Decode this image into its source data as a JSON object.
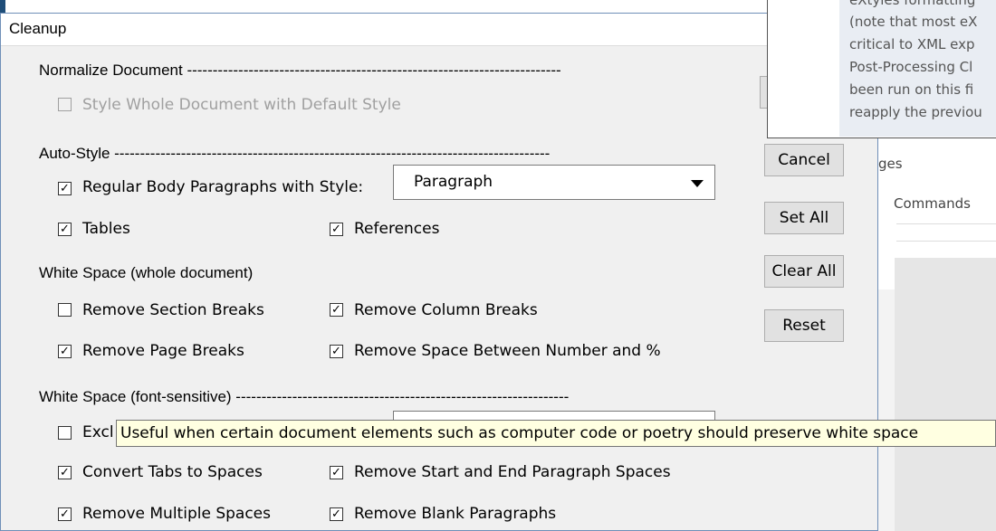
{
  "dialog": {
    "title": "Cleanup"
  },
  "normalize": {
    "header": "Normalize Document -------------------------------------------------------------------------",
    "style_whole": "Style Whole Document with Default Style"
  },
  "autostyle": {
    "header": "Auto-Style -------------------------------------------------------------------------------------",
    "regular_label": "Regular Body Paragraphs with Style:",
    "style_value": "Paragraph",
    "tables": "Tables",
    "references": "References"
  },
  "whitespace_doc": {
    "header": "White Space (whole document)",
    "remove_section": "Remove Section Breaks",
    "remove_column": "Remove Column Breaks",
    "remove_page": "Remove Page Breaks",
    "remove_space_pct": "Remove Space Between Number and %"
  },
  "whitespace_font": {
    "header": "White Space (font-sensitive) -----------------------------------------------------------------",
    "exclude_partial": "Excl",
    "convert_tabs": "Convert Tabs to Spaces",
    "remove_start_end": "Remove Start and End Paragraph Spaces",
    "remove_multiple": "Remove Multiple Spaces",
    "remove_blank": "Remove Blank Paragraphs"
  },
  "buttons": {
    "cancel": "Cancel",
    "set_all": "Set All",
    "clear_all": "Clear All",
    "reset": "Reset"
  },
  "tooltip": {
    "text": "Useful when certain document elements such as computer code or poetry should preserve white space"
  },
  "background_window": {
    "popup_lines": [
      "eXtyles formatting",
      "(note that most eX",
      "critical to XML exp",
      "Post-Processing Cl",
      "been run on this fi",
      "reapply the previou"
    ],
    "partial_1": "ges",
    "partial_2": "Commands"
  }
}
